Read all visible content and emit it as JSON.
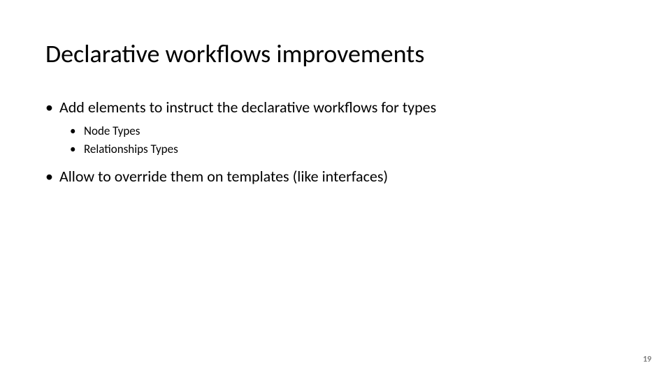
{
  "title": "Declarative workflows improvements",
  "bullets": {
    "item1": {
      "text": "Add elements to instruct the declarative workflows for types",
      "sub1": "Node Types",
      "sub2": "Relationships Types"
    },
    "item2": {
      "text": "Allow to override them on templates (like interfaces)"
    }
  },
  "page_number": "19"
}
